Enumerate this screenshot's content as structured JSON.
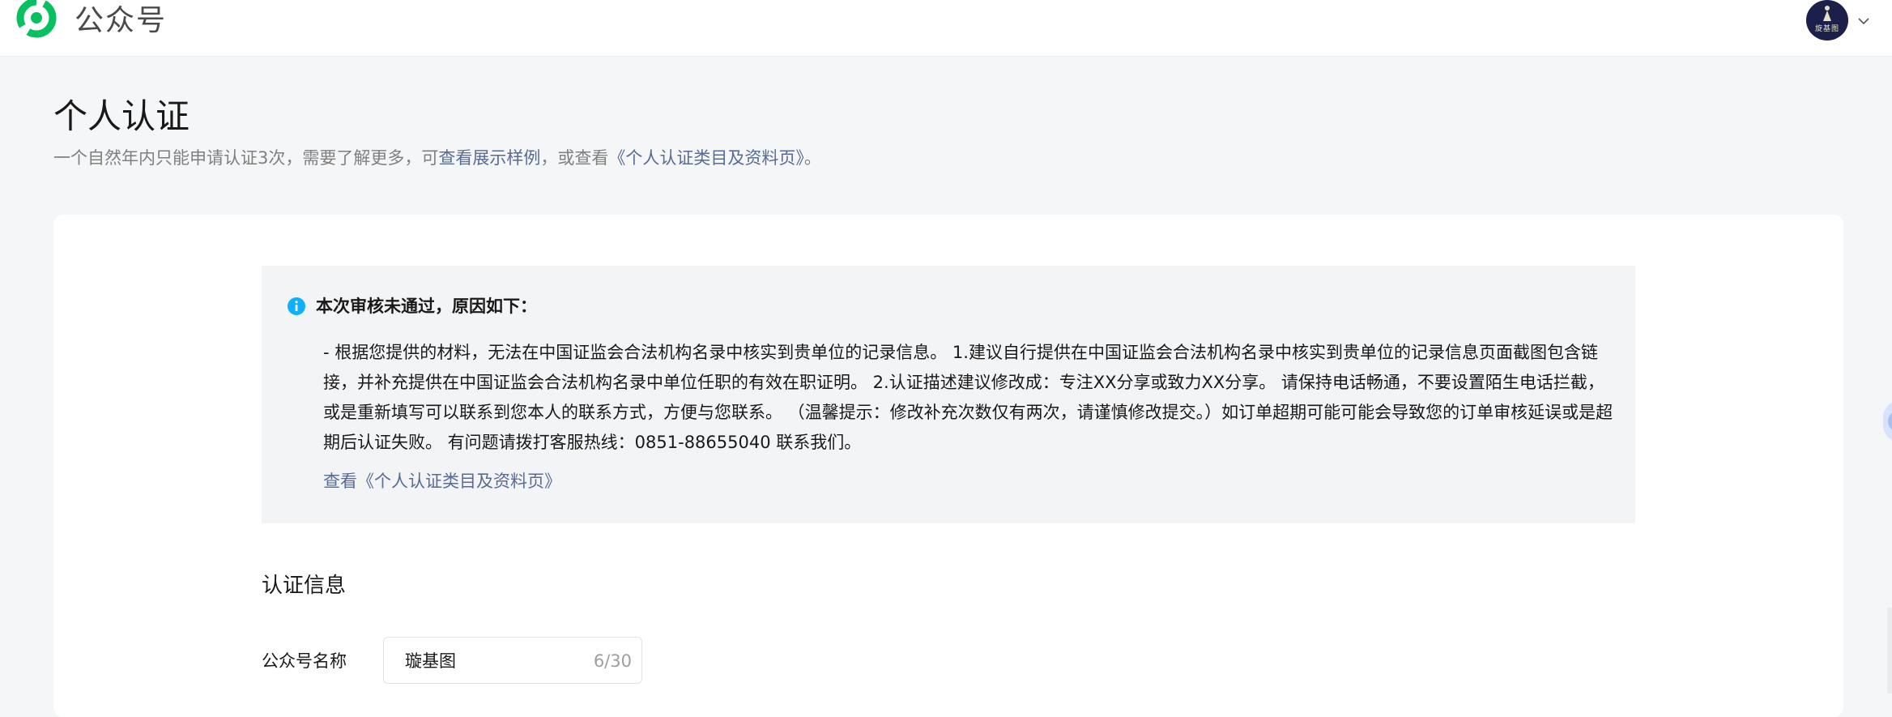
{
  "header": {
    "brand_name": "公众号",
    "logo_icon": "wechat-official-account-logo-icon",
    "avatar_text": "旋基图",
    "chevron_icon": "chevron-down-icon",
    "colors": {
      "logo_green": "#07c160",
      "avatar_bg": "#1b1f4a"
    }
  },
  "page": {
    "title": "个人认证",
    "subtitle_prefix": "一个自然年内只能申请认证3次，需要了解更多，可",
    "subtitle_link1": "查看展示样例",
    "subtitle_mid": "，或查看",
    "subtitle_link2": "《个人认证类目及资料页》",
    "subtitle_suffix": "。"
  },
  "notice": {
    "icon": "info-icon",
    "title": "本次审核未通过，原因如下：",
    "body": "- 根据您提供的材料，无法在中国证监会合法机构名录中核实到贵单位的记录信息。 1.建议自行提供在中国证监会合法机构名录中核实到贵单位的记录信息页面截图包含链接，并补充提供在中国证监会合法机构名录中单位任职的有效在职证明。 2.认证描述建议修改成：专注XX分享或致力XX分享。 请保持电话畅通，不要设置陌生电话拦截，或是重新填写可以联系到您本人的联系方式，方便与您联系。 （温馨提示：修改补充次数仅有两次，请谨慎修改提交。）如订单超期可能可能会导致您的订单审核延误或是超期后认证失败。 有问题请拨打客服热线：0851-88655040 联系我们。",
    "link": "查看《个人认证类目及资料页》",
    "colors": {
      "info_blue": "#10aeff",
      "link": "#576b95"
    }
  },
  "form": {
    "section_title": "认证信息",
    "account_name_label": "公众号名称",
    "account_name_value": "璇基图",
    "account_name_count": "6/30"
  }
}
